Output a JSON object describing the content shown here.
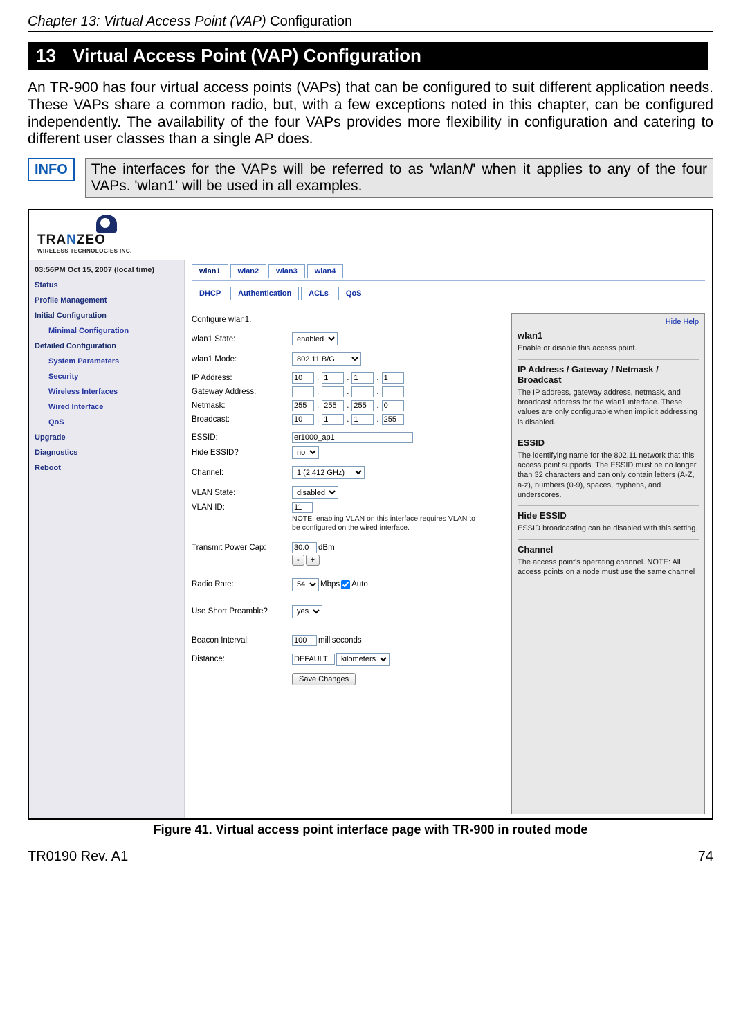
{
  "page": {
    "chapter_header_italic": "Chapter 13: Virtual Access Point (VAP)",
    "chapter_header_plain": " Configuration",
    "section_number": "13",
    "section_title": "Virtual Access Point (VAP) Configuration",
    "intro": "An TR-900 has four virtual access points (VAPs) that can be configured to suit different application needs. These VAPs share a common radio, but, with a few exceptions noted in this chapter, can be configured independently. The availability of the four VAPs provides more flexibility in configuration and catering to different user classes than a single AP does.",
    "info_badge": "INFO",
    "info_text_pre": "The interfaces for the VAPs will be referred to as 'wlan",
    "info_text_italic": "N",
    "info_text_post": "' when it applies to any of the four VAPs. 'wlan1' will be used in all examples.",
    "figure_caption": "Figure 41. Virtual access point interface page with TR-900 in routed mode",
    "footer_left": "TR0190 Rev. A1",
    "footer_right": "74"
  },
  "logo": {
    "word_pre": "TRA",
    "word_blue": "N",
    "word_post": "ZEO",
    "tagline": "WIRELESS TECHNOLOGIES INC."
  },
  "sidebar": {
    "time": "03:56PM Oct 15, 2007 (local time)",
    "items": [
      {
        "label": "Status",
        "type": "heading"
      },
      {
        "label": "Profile Management",
        "type": "heading"
      },
      {
        "label": "Initial Configuration",
        "type": "group"
      },
      {
        "label": "Minimal Configuration",
        "type": "sub"
      },
      {
        "label": "Detailed Configuration",
        "type": "group"
      },
      {
        "label": "System Parameters",
        "type": "sub"
      },
      {
        "label": "Security",
        "type": "sub"
      },
      {
        "label": "Wireless Interfaces",
        "type": "sub"
      },
      {
        "label": "Wired Interface",
        "type": "sub"
      },
      {
        "label": "QoS",
        "type": "sub"
      },
      {
        "label": "Upgrade",
        "type": "heading"
      },
      {
        "label": "Diagnostics",
        "type": "heading"
      },
      {
        "label": "Reboot",
        "type": "heading"
      }
    ]
  },
  "tabs": [
    "wlan1",
    "wlan2",
    "wlan3",
    "wlan4"
  ],
  "subtabs": [
    "DHCP",
    "Authentication",
    "ACLs",
    "QoS"
  ],
  "form": {
    "configure": "Configure wlan1.",
    "state_label": "wlan1 State:",
    "state_value": "enabled",
    "mode_label": "wlan1 Mode:",
    "mode_value": "802.11 B/G",
    "ip_label": "IP Address:",
    "ip": [
      "10",
      "1",
      "1",
      "1"
    ],
    "gw_label": "Gateway Address:",
    "gw": [
      "",
      "",
      "",
      ""
    ],
    "nm_label": "Netmask:",
    "nm": [
      "255",
      "255",
      "255",
      "0"
    ],
    "bc_label": "Broadcast:",
    "bc": [
      "10",
      "1",
      "1",
      "255"
    ],
    "essid_label": "ESSID:",
    "essid_value": "er1000_ap1",
    "hide_label": "Hide ESSID?",
    "hide_value": "no",
    "channel_label": "Channel:",
    "channel_value": "1 (2.412 GHz)",
    "vlan_state_label": "VLAN State:",
    "vlan_state_value": "disabled",
    "vlan_id_label": "VLAN ID:",
    "vlan_id_value": "11",
    "vlan_note": "NOTE: enabling VLAN on this interface requires VLAN to be configured on the wired interface.",
    "tx_label": "Transmit Power Cap:",
    "tx_value": "30.0",
    "tx_unit": "dBm",
    "tx_minus": "-",
    "tx_plus": "+",
    "rate_label": "Radio Rate:",
    "rate_value": "54",
    "rate_unit": "Mbps",
    "rate_auto": "Auto",
    "preamble_label": "Use Short Preamble?",
    "preamble_value": "yes",
    "beacon_label": "Beacon Interval:",
    "beacon_value": "100",
    "beacon_unit": "milliseconds",
    "distance_label": "Distance:",
    "distance_value": "DEFAULT",
    "distance_unit": "kilometers",
    "save": "Save Changes"
  },
  "help": {
    "hide": "Hide Help",
    "h1": "wlan1",
    "p1": "Enable or disable this access point.",
    "h2": "IP Address / Gateway / Netmask / Broadcast",
    "p2": "The IP address, gateway address, netmask, and broadcast address for the wlan1 interface. These values are only configurable when implicit addressing is disabled.",
    "h3": "ESSID",
    "p3": "The identifying name for the 802.11 network that this access point supports. The ESSID must be no longer than 32 characters and can only contain letters (A-Z, a-z), numbers (0-9), spaces, hyphens, and underscores.",
    "h4": "Hide ESSID",
    "p4": "ESSID broadcasting can be disabled with this setting.",
    "h5": "Channel",
    "p5": "The access point's operating channel. NOTE: All access points on a node must use the same channel"
  }
}
